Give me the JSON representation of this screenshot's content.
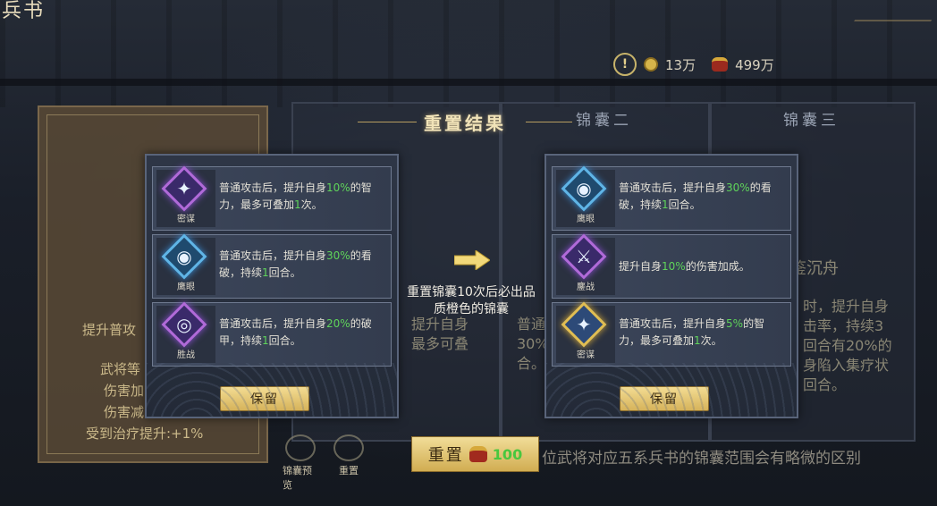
{
  "page": {
    "title": "兵书"
  },
  "currency": {
    "coins": "13万",
    "items": "499万"
  },
  "background": {
    "col2_header": "锦囊二",
    "col3_header": "锦囊三",
    "left_label": "提升普攻",
    "left_lines": [
      "武将等",
      "伤害加",
      "伤害减",
      "受到治疗提升:+1%"
    ],
    "col3_name": "鉴沉舟",
    "col3_lines": [
      "时，提升自身",
      "击率，持续3",
      "回合有20%的",
      "身陷入集疗状",
      "回合。"
    ],
    "mid_lines": [
      "提升自身",
      "最多可叠"
    ],
    "col2_lines": [
      "普通",
      "30%",
      "合。"
    ]
  },
  "result": {
    "title": "重置结果",
    "notice": "重置锦囊10次后必出品质橙色的锦囊",
    "keep_label": "保留",
    "left_skills": [
      {
        "name": "密谋",
        "desc_parts": [
          "普通攻击后，提升自身",
          "10%",
          "的智力，最多可叠加",
          "1",
          "次。"
        ]
      },
      {
        "name": "鹰眼",
        "desc_parts": [
          "普通攻击后，提升自身",
          "30%",
          "的看破，持续",
          "1",
          "回合。"
        ]
      },
      {
        "name": "胜战",
        "desc_parts": [
          "普通攻击后，提升自身",
          "20%",
          "的破甲，持续",
          "1",
          "回合。"
        ]
      }
    ],
    "right_skills": [
      {
        "name": "鹰眼",
        "desc_parts": [
          "普通攻击后，提升自身",
          "30%",
          "的看破，持续",
          "1",
          "回合。"
        ]
      },
      {
        "name": "鏖战",
        "desc_parts": [
          "提升自身",
          "10%",
          "的伤害加成。",
          "",
          ""
        ]
      },
      {
        "name": "密谋",
        "desc_parts": [
          "普通攻击后，提升自身",
          "5%",
          "的智力，最多可叠加",
          "1",
          "次。"
        ]
      }
    ]
  },
  "bottom": {
    "reset_label": "重置",
    "reset_cost": "100",
    "note": "位武将对应五系兵书的锦囊范围会有略微的区别",
    "icons": [
      {
        "label": "锦囊预览"
      },
      {
        "label": "重置"
      }
    ]
  },
  "colors": {
    "highlight": "#5fd45a",
    "button_gold": "#d6b35a"
  }
}
